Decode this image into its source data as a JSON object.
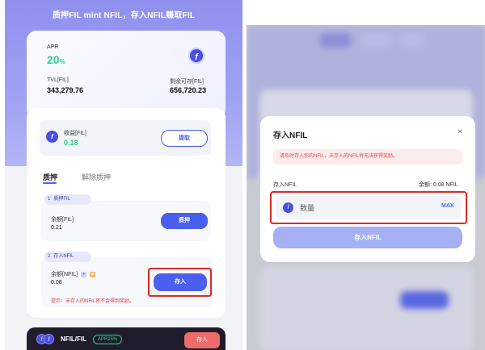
{
  "left": {
    "banner": "质押FIL mint NFIL，存入NFIL赚取FIL",
    "stats": {
      "apr_label": "APR",
      "apr_value": "20",
      "apr_unit": "%",
      "tvl_label": "TVL[FIL]",
      "tvl_value": "343,279.76",
      "remain_label": "剩余可存[FIL]",
      "remain_value": "656,720.23"
    },
    "earnings": {
      "label": "收益[FIL]",
      "value": "0.18",
      "withdraw_label": "提取"
    },
    "tabs": {
      "stake": "质押",
      "unstake": "解除质押"
    },
    "step1": {
      "number": "1",
      "title": "质押FIL",
      "balance_label": "余额[FIL]",
      "balance_value": "0.21",
      "button_label": "质押"
    },
    "step2": {
      "number": "2",
      "title": "存入NFIL",
      "balance_label": "余额[NFIL]",
      "balance_value": "0.08",
      "button_label": "存入",
      "hint": "提示：未存入的NFIL将不会得到奖励。"
    },
    "pool": {
      "pair_name": "NFIL/FIL",
      "apr_badge": "APR25%",
      "deposit_label": "存入"
    }
  },
  "modal": {
    "title": "存入NFIL",
    "close_glyph": "×",
    "alert": "请及时存入你的NFIL，未存入的NFIL将无法获得奖励。",
    "field_label": "存入NFIL",
    "balance_text": "余额: 0.08 NFIL",
    "input_placeholder": "数量",
    "max_label": "MAX",
    "submit_label": "存入NFIL"
  },
  "colors": {
    "accent": "#4a5ff0",
    "success": "#2ecc8f",
    "danger": "#e02828",
    "hero": "#9fa3f2"
  },
  "icons": {
    "fil": "fil-token-icon",
    "close": "close-icon"
  }
}
